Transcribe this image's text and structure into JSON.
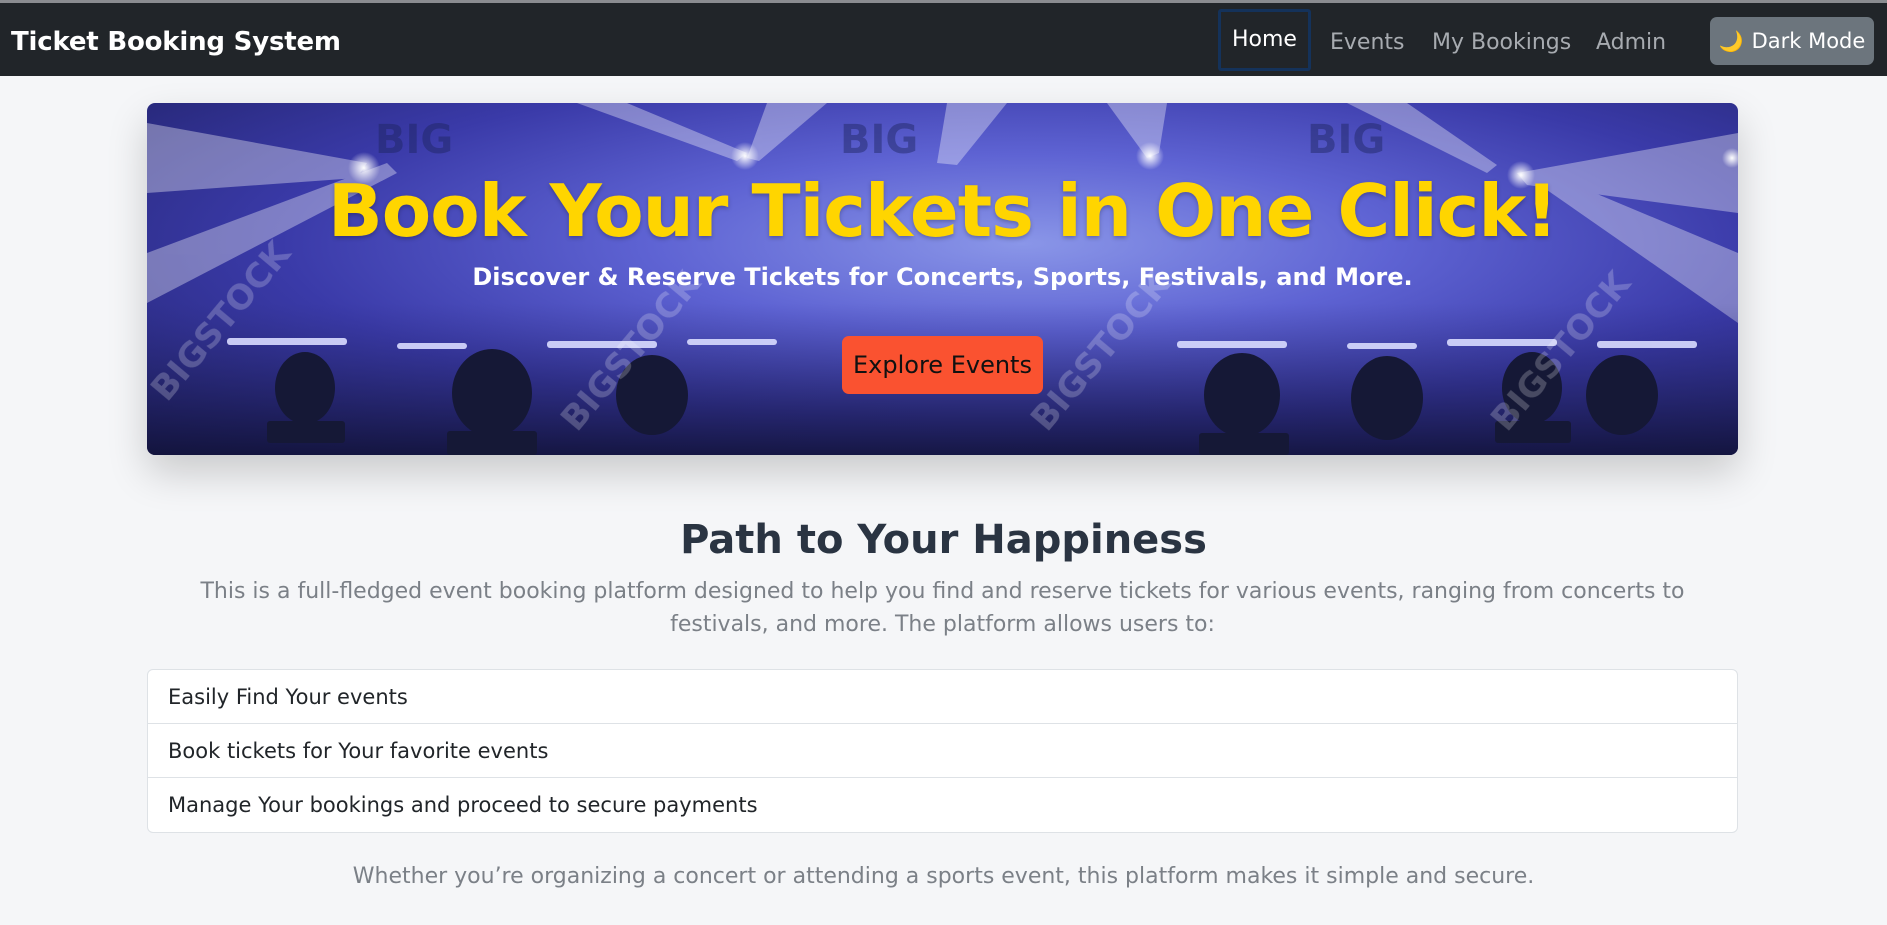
{
  "navbar": {
    "brand": "Ticket Booking System",
    "links": [
      "Home",
      "Events",
      "My Bookings",
      "Admin"
    ],
    "active": "Home",
    "dark_mode_icon": "🌙",
    "dark_mode_label": "Dark Mode"
  },
  "hero": {
    "title": "Book Your Tickets in One Click!",
    "subtitle": "Discover & Reserve Tickets for Concerts, Sports, Festivals, and More.",
    "button_label": "Explore Events",
    "watermark_text": "BIG",
    "watermark_text_diag": "BIGSTOCK"
  },
  "about": {
    "title": "Path to Your Happiness",
    "intro": "This is a full-fledged event booking platform designed to help you find and reserve tickets for various events, ranging from concerts to festivals, and more. The platform allows users to:",
    "features": [
      "Easily Find Your events",
      "Book tickets for Your favorite events",
      "Manage Your bookings and proceed to secure payments"
    ],
    "outro": "Whether you’re organizing a concert or attending a sports event, this platform makes it simple and secure."
  },
  "colors": {
    "navbar_bg": "#212529",
    "hero_title": "#ffd500",
    "explore_button": "#fa5230",
    "dark_mode_button": "#6c757d"
  }
}
